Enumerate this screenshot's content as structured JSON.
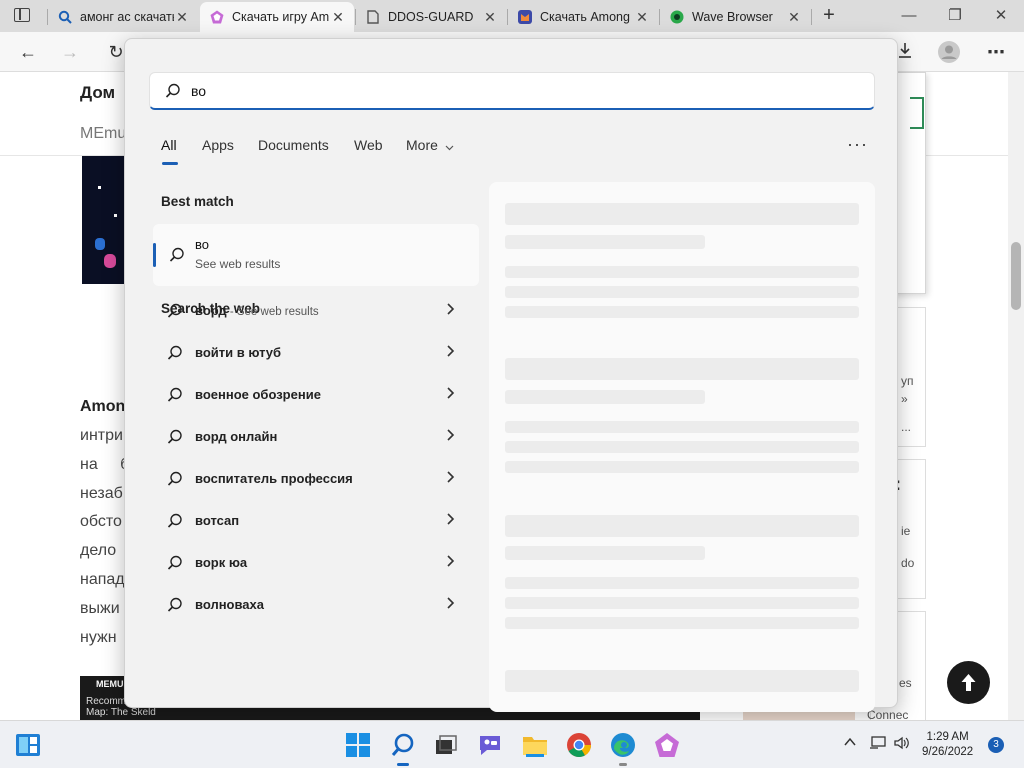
{
  "browser": {
    "tabs": [
      {
        "title": "амонг ас скачать",
        "favicon_color": "#1b5fb5"
      },
      {
        "title": "Скачать игру Am",
        "favicon_color": "#c66bd6"
      },
      {
        "title": "DDOS-GUARD",
        "favicon_color": "#555555"
      },
      {
        "title": "Скачать Among",
        "favicon_color": "#3d4aa8"
      },
      {
        "title": "Wave Browser",
        "favicon_color": "#2aa84a"
      }
    ]
  },
  "page": {
    "heading": "Дом",
    "subheading": "MEmu",
    "article_title": "Amon",
    "article_lines": [
      "интри",
      "на б",
      "незаб",
      "обсто",
      "дело",
      "напад",
      "выжи",
      "нужн"
    ],
    "side_text": [
      "уп",
      "»",
      "...",
      ":",
      "ie",
      "do",
      "es",
      "Connec"
    ],
    "banner_brand": "MEMU",
    "banner_line1": "Recomm",
    "banner_line2": "Map: The Skeld"
  },
  "search": {
    "query": "во",
    "filters": [
      "All",
      "Apps",
      "Documents",
      "Web",
      "More"
    ],
    "more_chevron": "chevron-down-icon",
    "best_match_heading": "Best match",
    "best_match": {
      "title": "во",
      "subtitle": "See web results"
    },
    "web_heading": "Search the web",
    "suggestions": [
      {
        "text": "ворд",
        "sub": " - See web results"
      },
      {
        "text": "войти в ютуб",
        "sub": ""
      },
      {
        "text": "военное обозрение",
        "sub": ""
      },
      {
        "text": "ворд онлайн",
        "sub": ""
      },
      {
        "text": "воспитатель профессия",
        "sub": ""
      },
      {
        "text": "вотсап",
        "sub": ""
      },
      {
        "text": "ворк юа",
        "sub": ""
      },
      {
        "text": "волноваха",
        "sub": ""
      }
    ]
  },
  "taskbar": {
    "time": "1:29 AM",
    "date": "9/26/2022",
    "notification_count": "3"
  },
  "colors": {
    "accent": "#1b5fb5"
  }
}
